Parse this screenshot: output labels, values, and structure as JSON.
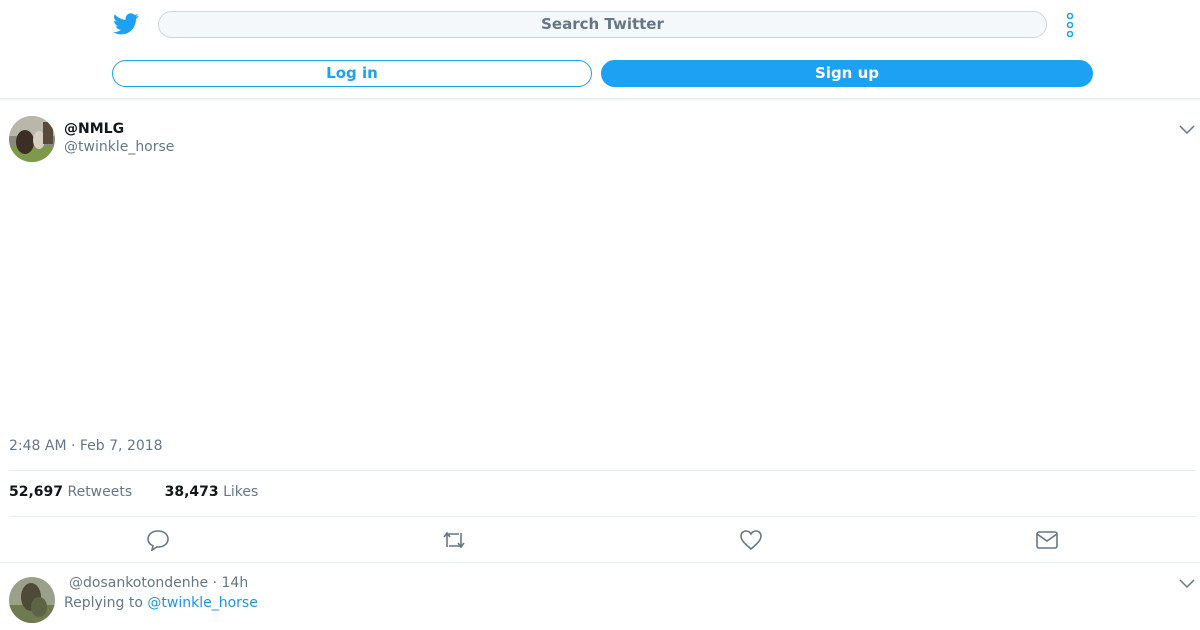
{
  "header": {
    "search_placeholder": "Search Twitter",
    "login_label": "Log in",
    "signup_label": "Sign up",
    "accent_color": "#1da1f2"
  },
  "tweet": {
    "display_name": "@NMLG",
    "handle": "@twinkle_horse",
    "timestamp": "2:48 AM · Feb 7, 2018",
    "retweets_count": "52,697",
    "retweets_label": "Retweets",
    "likes_count": "38,473",
    "likes_label": "Likes",
    "actions": [
      "reply-icon",
      "retweet-icon",
      "like-icon",
      "dm-icon"
    ]
  },
  "reply": {
    "handle_time": "@dosankotondenhe · 14h",
    "replying_prefix": "Replying to ",
    "replying_handle": "@twinkle_horse"
  }
}
